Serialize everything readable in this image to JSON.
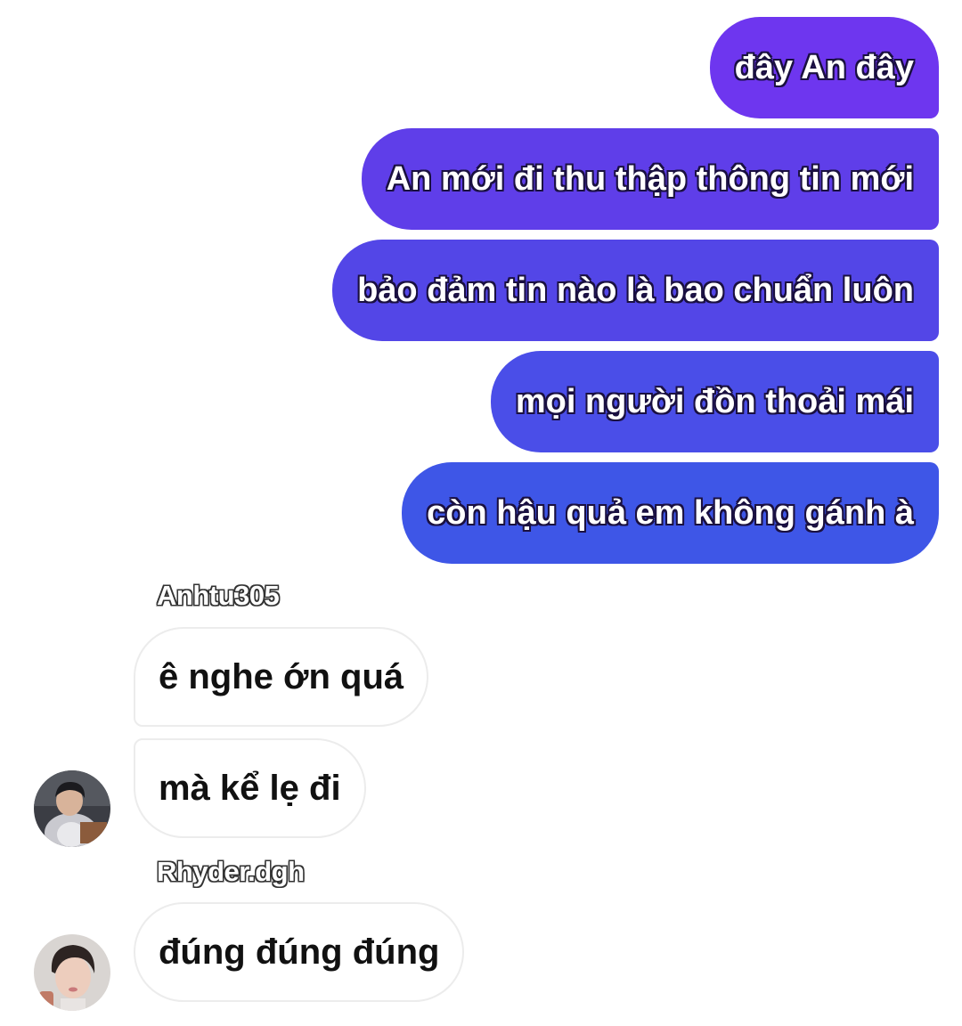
{
  "outgoing_messages": [
    {
      "text": "đây An đây"
    },
    {
      "text": "An mới đi thu thập thông tin mới"
    },
    {
      "text": "bảo đảm tin nào là bao chuẩn luôn"
    },
    {
      "text": "mọi người đồn thoải mái"
    },
    {
      "text": "còn hậu quả em không gánh à"
    }
  ],
  "incoming_groups": [
    {
      "sender": "Anhtu305",
      "avatar_icon": "user-avatar-photo",
      "messages": [
        {
          "text": "ê nghe ớn quá"
        },
        {
          "text": "mà kể lẹ đi"
        }
      ]
    },
    {
      "sender": "Rhyder.dgh",
      "avatar_icon": "user-avatar-photo",
      "messages": [
        {
          "text": "đúng đúng đúng"
        }
      ]
    }
  ],
  "colors": {
    "outgoing_gradient_top": "#6e36ef",
    "outgoing_gradient_bottom": "#3e56e7",
    "incoming_bubble_bg": "#ffffff",
    "incoming_bubble_border": "#ececec"
  }
}
